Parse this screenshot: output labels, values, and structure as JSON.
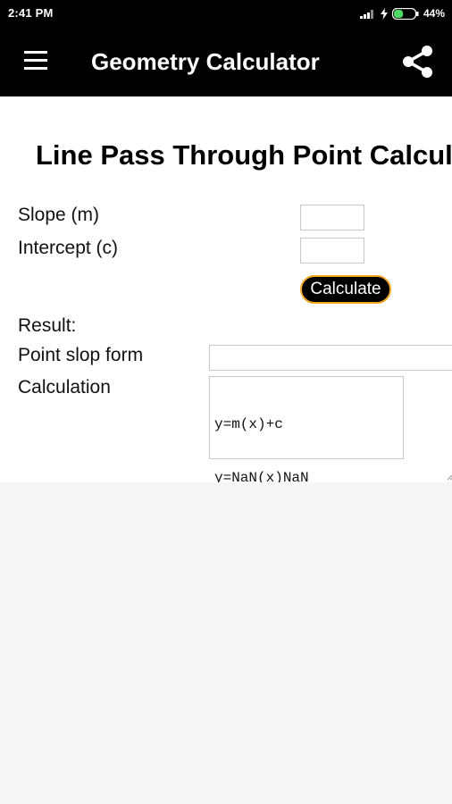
{
  "status_bar": {
    "time": "2:41 PM",
    "battery_percent": "44%",
    "battery_level": 0.44
  },
  "app_bar": {
    "title": "Geometry Calculator",
    "menu_icon": "hamburger-menu-icon",
    "share_icon": "share-icon"
  },
  "main": {
    "page_title": "Line Pass Through Point Calculator",
    "slope_label": "Slope (m)",
    "slope_value": "",
    "intercept_label": "Intercept (c)",
    "intercept_value": "",
    "calculate_label": "Calculate",
    "result_label": "Result:",
    "point_slope_label": "Point slop form",
    "point_slope_value": "",
    "calculation_label": "Calculation",
    "calculation_lines": [
      "y=m(x)+c",
      "y=NaN(x)NaN"
    ]
  },
  "colors": {
    "app_bar": "#000000",
    "button_bg": "#000000",
    "button_border": "#f5a623",
    "background": "#f6f6f6"
  }
}
